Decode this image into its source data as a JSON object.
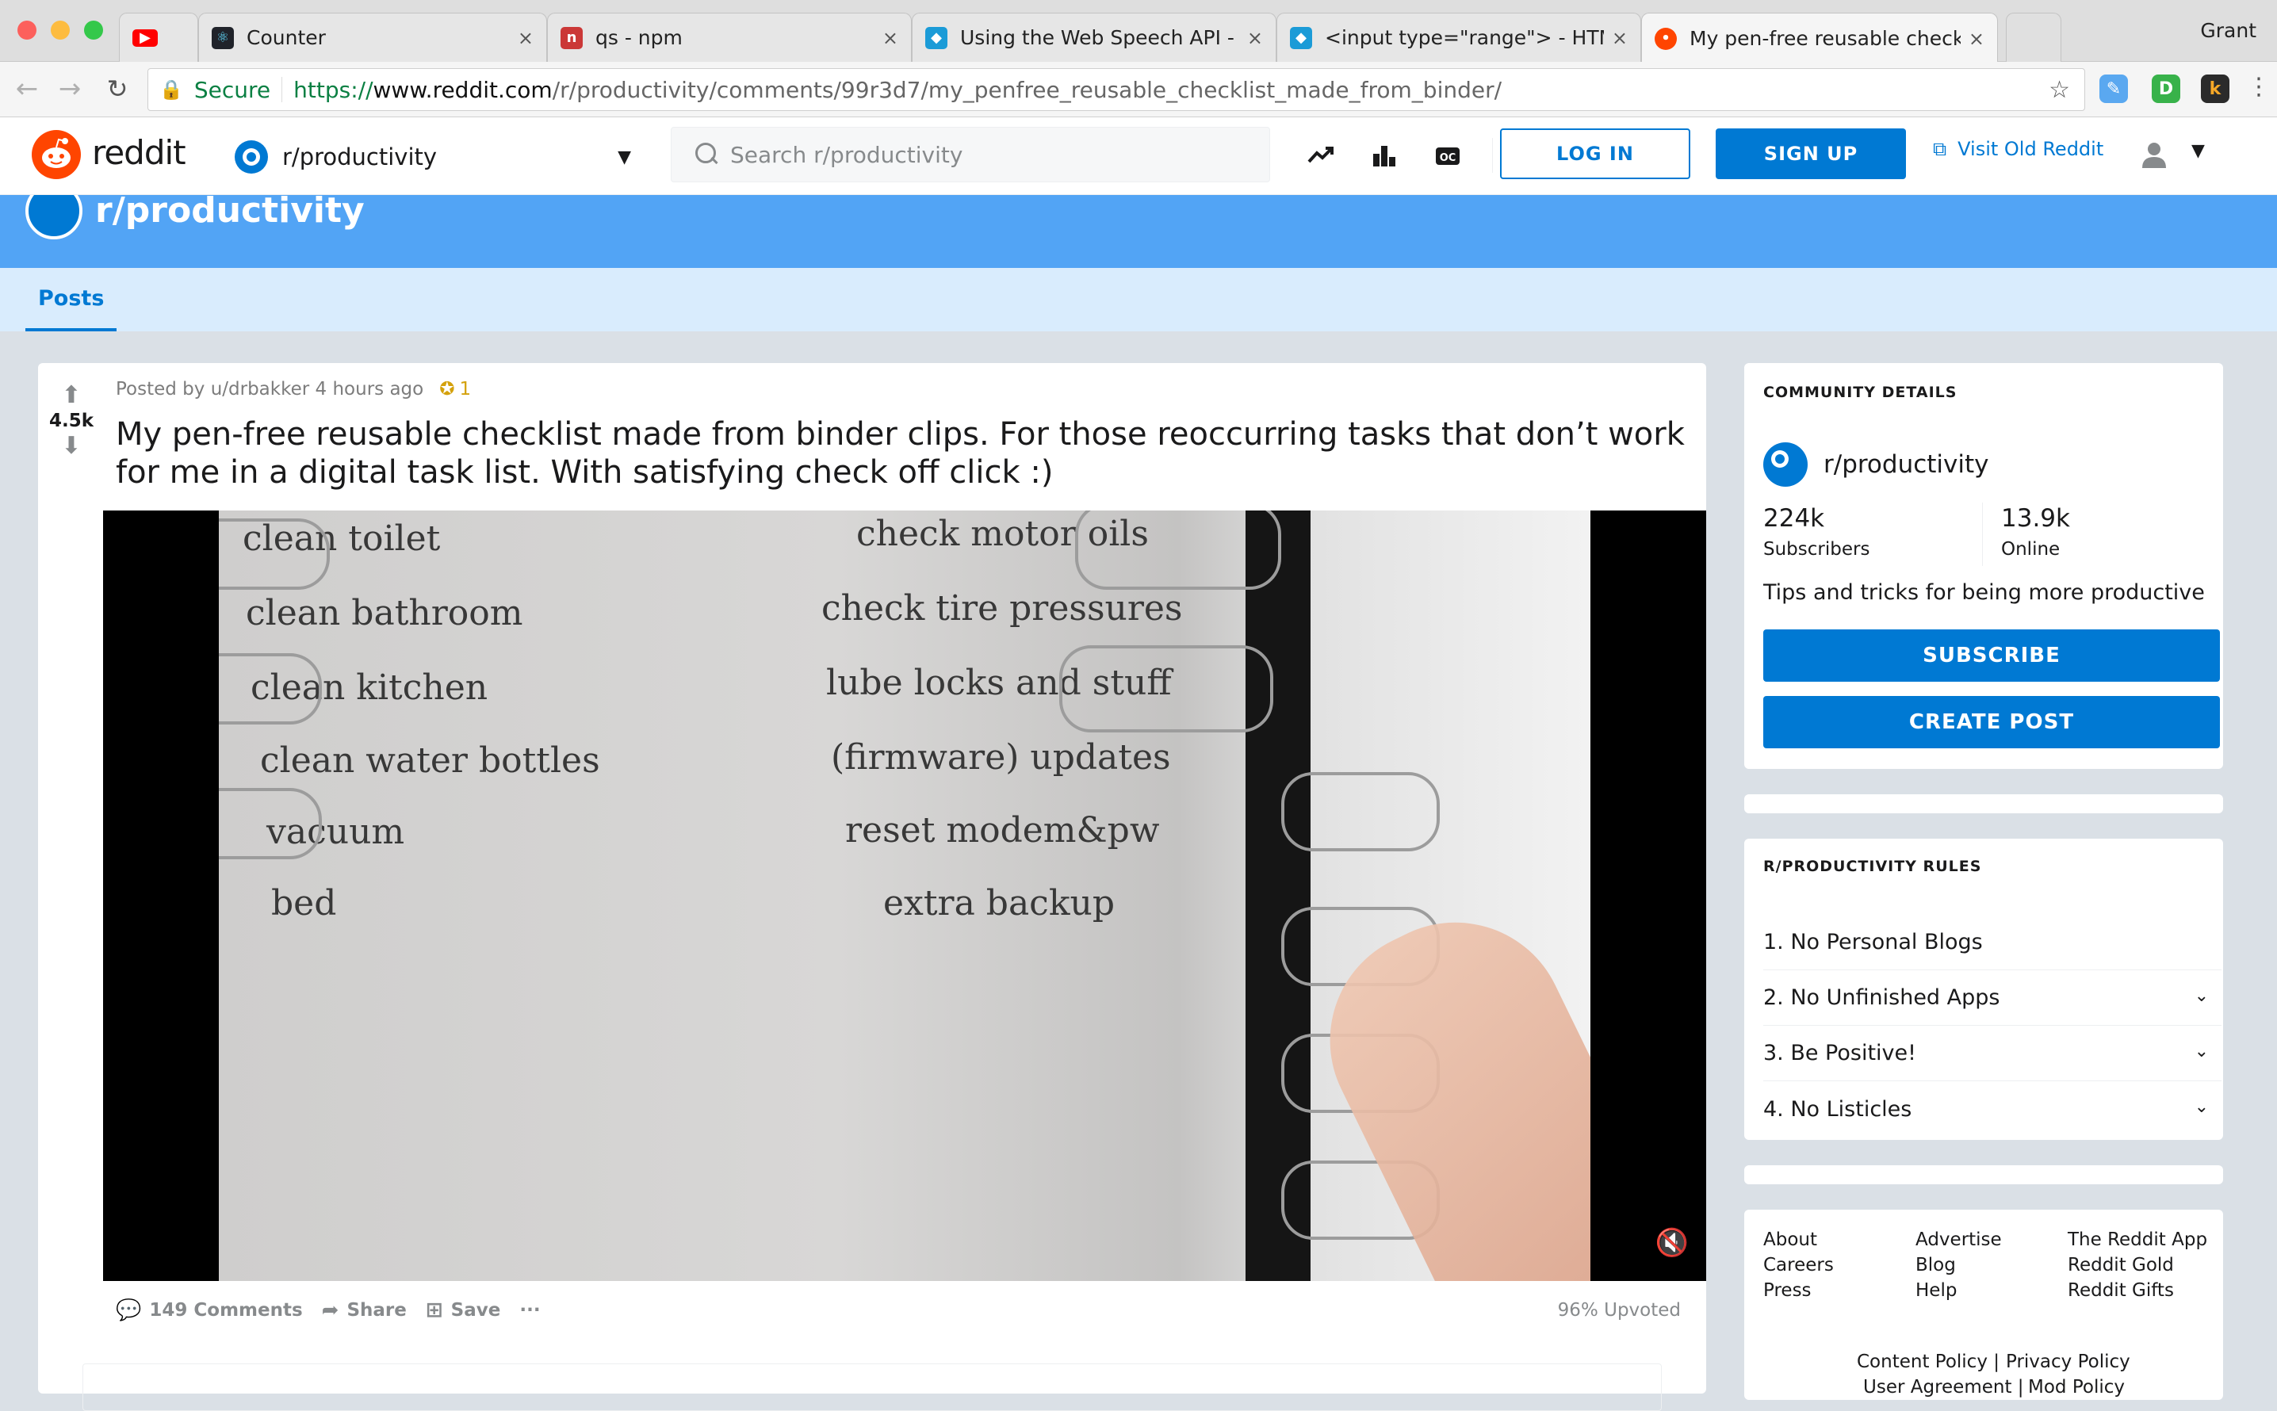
{
  "browser": {
    "tabs": [
      {
        "title": "",
        "icon": "youtube-icon",
        "color": "#ff0000"
      },
      {
        "title": "Counter",
        "icon": "react-icon",
        "color": "#20232a"
      },
      {
        "title": "qs - npm",
        "icon": "npm-icon",
        "color": "#cb3837"
      },
      {
        "title": "Using the Web Speech API - W",
        "icon": "mdn-icon",
        "color": "#1b9bd7"
      },
      {
        "title": "<input type=\"range\"> - HTML",
        "icon": "mdn-icon",
        "color": "#1b9bd7"
      },
      {
        "title": "My pen-free reusable checklis",
        "icon": "reddit-icon",
        "color": "#ff4500",
        "active": true
      }
    ],
    "close": "×",
    "profile": "Grant",
    "url": {
      "secure": "Secure",
      "protocol": "https://",
      "host": "www.reddit.com",
      "path": "/r/productivity/comments/99r3d7/my_penfree_reusable_checklist_made_from_binder/"
    }
  },
  "header": {
    "brand": "reddit",
    "community": "r/productivity",
    "search_placeholder": "Search r/productivity",
    "login": "LOG IN",
    "signup": "SIGN UP",
    "old_reddit": "Visit Old Reddit",
    "icons": [
      "trending-icon",
      "leaderboard-icon",
      "oc-icon"
    ]
  },
  "banner": {
    "title": "r/productivity"
  },
  "nav": {
    "posts": "Posts"
  },
  "post": {
    "score": "4.5k",
    "meta": "Posted by u/drbakker 4 hours ago",
    "award_count": "1",
    "title": "My pen-free reusable checklist made from binder clips. For those reoccurring tasks that don’t work for me in a digital task list. With satisfying check off click :)",
    "image_left_labels": [
      "clean toilet",
      "clean bathroom",
      "clean kitchen",
      "clean water bottles",
      "vacuum",
      "bed"
    ],
    "image_right_labels": [
      "check motor oils",
      "check tire pressures",
      "lube locks and stuff",
      "(firmware) updates",
      "reset modem&pw",
      "extra backup"
    ],
    "comments": "149 Comments",
    "share": "Share",
    "save": "Save",
    "more": "···",
    "upvoted": "96% Upvoted"
  },
  "community": {
    "heading": "COMMUNITY DETAILS",
    "name": "r/productivity",
    "subscribers": "224k",
    "subscribers_label": "Subscribers",
    "online": "13.9k",
    "online_label": "Online",
    "description": "Tips and tricks for being more productive",
    "subscribe": "SUBSCRIBE",
    "create_post": "CREATE POST"
  },
  "rules": {
    "heading": "R/PRODUCTIVITY RULES",
    "items": [
      "1. No Personal Blogs",
      "2. No Unfinished Apps",
      "3. Be Positive!",
      "4. No Listicles"
    ]
  },
  "footer": {
    "col1": [
      "About",
      "Careers",
      "Press"
    ],
    "col2": [
      "Advertise",
      "Blog",
      "Help"
    ],
    "col3": [
      "The Reddit App",
      "Reddit Gold",
      "Reddit Gifts"
    ],
    "content_policy": "Content Policy |",
    "privacy_policy": "Privacy Policy",
    "user_agreement": "User Agreement |",
    "mod_policy": "Mod Policy"
  },
  "colors": {
    "accent": "#0079d3",
    "banner": "#52a4f5",
    "nav": "#d9ecfd",
    "reddit_orange": "#ff4500"
  }
}
